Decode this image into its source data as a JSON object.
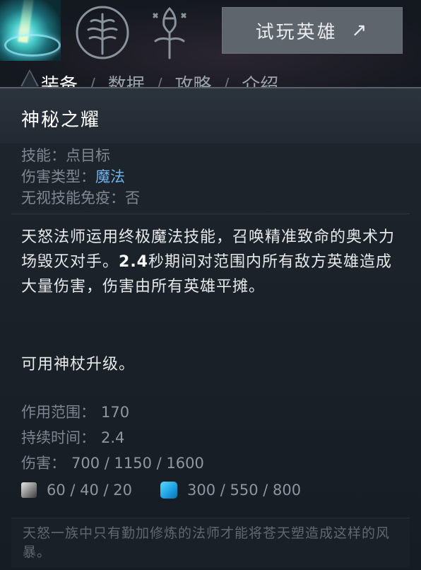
{
  "header": {
    "ability_icon": "arcane-storm-icon",
    "talent_icons": [
      "talent-tree-icon",
      "aghanims-scepter-icon"
    ],
    "try_hero_label": "试玩英雄",
    "try_hero_icon": "arrow-up-right-icon",
    "tabs": [
      {
        "label": "装备",
        "active": true
      },
      {
        "label": "数据",
        "active": false
      },
      {
        "label": "攻略",
        "active": false
      },
      {
        "label": "介绍",
        "active": false
      }
    ],
    "tab_separator": "/"
  },
  "tooltip": {
    "title": "神秘之耀",
    "properties": {
      "ability_label": "技能：",
      "ability_value": "点目标",
      "damage_type_label": "伤害类型：",
      "damage_type_value": "魔法",
      "pierces_immunity_label": "无视技能免疫：",
      "pierces_immunity_value": "否"
    },
    "description": {
      "part1": "天怒法师运用终极魔法技能，召唤精准致命的奥术力场毁灭对手。",
      "duration": "2.4",
      "part2": "秒期间对范围内所有敌方英雄造成大量伤害，伤害由所有英雄平摊。"
    },
    "upgrade_note": "可用神杖升级。",
    "stats": [
      {
        "label": "作用范围：",
        "value": "170"
      },
      {
        "label": "持续时间：",
        "value": "2.4"
      },
      {
        "label": "伤害：",
        "value": "700 / 1150 / 1600"
      }
    ],
    "cooldown": {
      "icon": "cooldown-icon",
      "value": "60 / 40 / 20"
    },
    "mana_cost": {
      "icon": "mana-icon",
      "value": "300 / 550 / 800"
    },
    "lore": "天怒一族中只有勤加修炼的法师才能将苍天塑造成这样的风暴。"
  },
  "colors": {
    "accent_magic": "#6fb2ee",
    "mana": "#1a9fe0",
    "panel_bg": "#1e252d"
  }
}
